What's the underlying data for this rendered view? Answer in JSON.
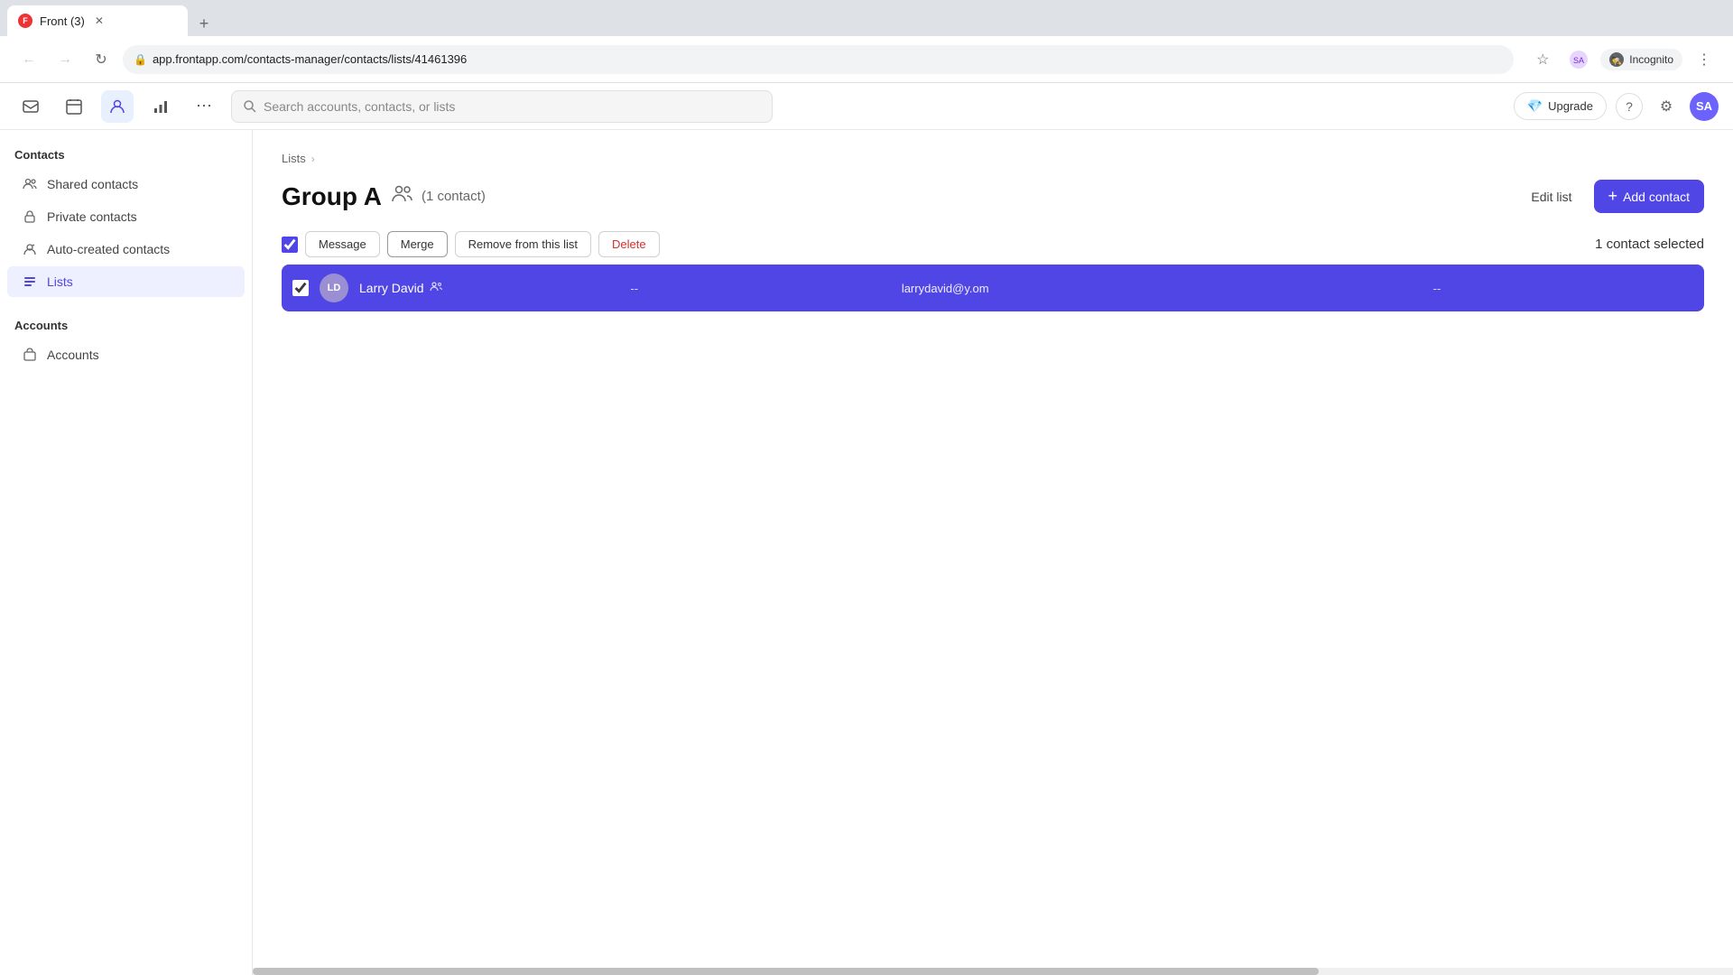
{
  "browser": {
    "tab_title": "Front (3)",
    "tab_favicon": "F",
    "url": "app.frontapp.com/contacts-manager/contacts/lists/41461396",
    "incognito_label": "Incognito",
    "new_tab_symbol": "+"
  },
  "topbar": {
    "search_placeholder": "Search accounts, contacts, or lists",
    "upgrade_label": "Upgrade",
    "help_icon": "?",
    "settings_icon": "⚙",
    "avatar_initials": "SA"
  },
  "sidebar": {
    "contacts_section_label": "Contacts",
    "items": [
      {
        "id": "shared-contacts",
        "label": "Shared contacts",
        "icon": "👥"
      },
      {
        "id": "private-contacts",
        "label": "Private contacts",
        "icon": "🔒"
      },
      {
        "id": "auto-created-contacts",
        "label": "Auto-created contacts",
        "icon": "✨"
      },
      {
        "id": "lists",
        "label": "Lists",
        "icon": "📋",
        "active": true
      }
    ],
    "accounts_section_label": "Accounts",
    "account_items": [
      {
        "id": "accounts",
        "label": "Accounts",
        "icon": "🏢"
      }
    ]
  },
  "breadcrumb": {
    "parent_label": "Lists",
    "separator": "›"
  },
  "page": {
    "title": "Group A",
    "group_icon": "👥",
    "contact_count": "(1 contact)",
    "edit_list_label": "Edit list",
    "add_contact_label": "Add contact",
    "add_contact_icon": "+"
  },
  "toolbar": {
    "message_label": "Message",
    "merge_label": "Merge",
    "remove_label": "Remove from this list",
    "delete_label": "Delete",
    "selected_label": "1 contact selected"
  },
  "contacts": [
    {
      "id": 1,
      "initials": "LD",
      "name": "Larry David",
      "shared_icon": "👥",
      "field1": "--",
      "email": "larrydavid@y.om",
      "field2": "--",
      "selected": true
    }
  ],
  "icons": {
    "back": "←",
    "forward": "→",
    "reload": "↻",
    "star": "☆",
    "menu": "⋮",
    "lock": "🔒",
    "search": "🔍",
    "gem": "💎",
    "more": "⋮",
    "chevron_right": "›"
  }
}
